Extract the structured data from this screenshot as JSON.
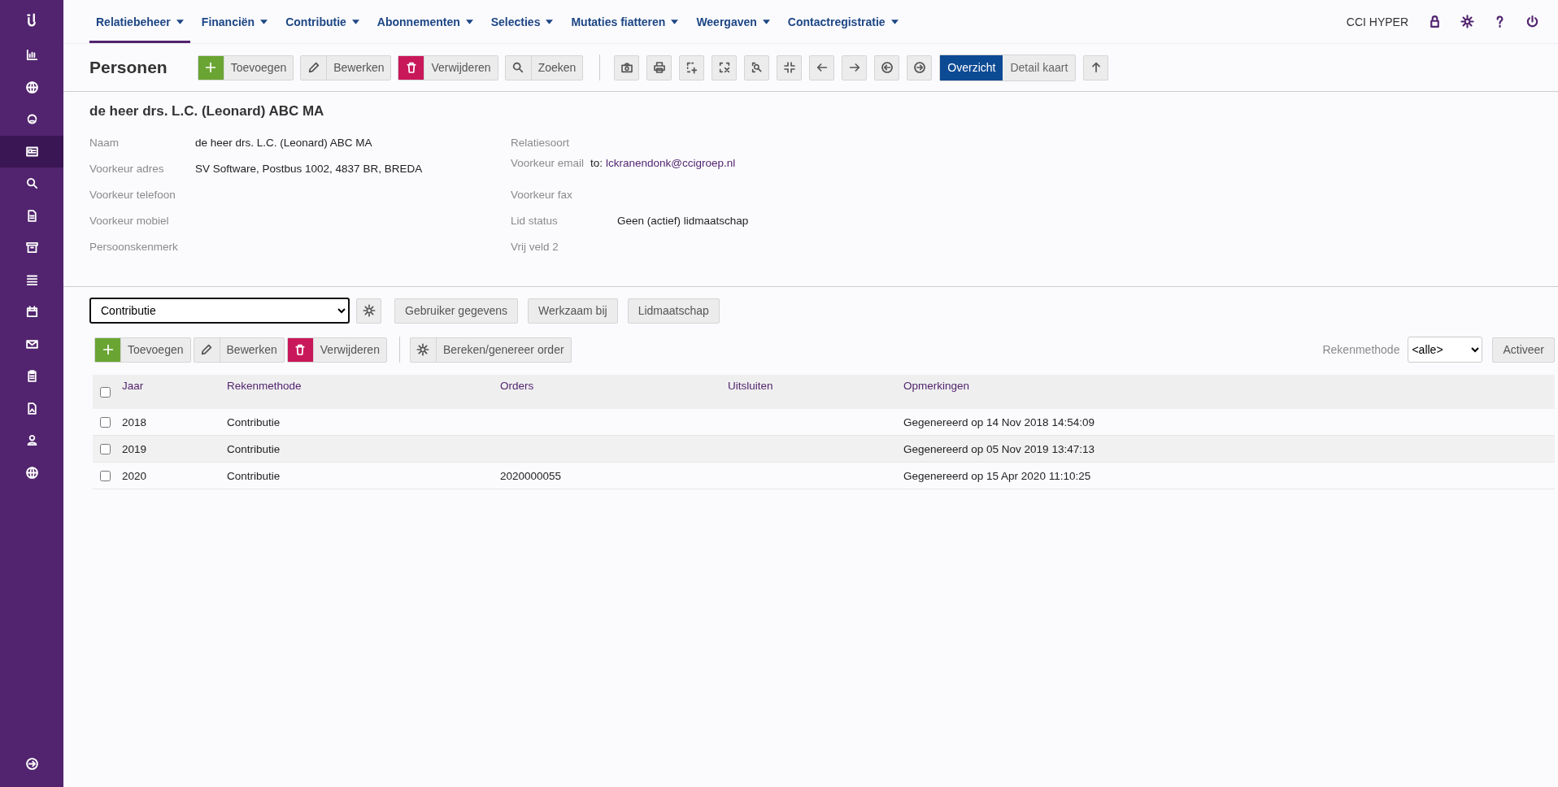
{
  "sidebar": {
    "logo": {
      "kind": "logo"
    },
    "items": [
      {
        "kind": "chart",
        "selected": false
      },
      {
        "kind": "globe",
        "selected": false
      },
      {
        "kind": "circle",
        "selected": false
      },
      {
        "kind": "idcard",
        "selected": true
      },
      {
        "kind": "search",
        "selected": false
      },
      {
        "kind": "document",
        "selected": false
      },
      {
        "kind": "archive",
        "selected": false
      },
      {
        "kind": "list",
        "selected": false
      },
      {
        "kind": "calendar",
        "selected": false
      },
      {
        "kind": "envelope",
        "selected": false
      },
      {
        "kind": "clipboard",
        "selected": false
      },
      {
        "kind": "fileimage",
        "selected": false
      },
      {
        "kind": "user",
        "selected": false
      },
      {
        "kind": "globe",
        "selected": false
      }
    ],
    "bottom": {
      "kind": "circle-right"
    }
  },
  "top_nav": {
    "menus": [
      {
        "label": "Relatiebeheer",
        "selected": true
      },
      {
        "label": "Financiën",
        "selected": false
      },
      {
        "label": "Contributie",
        "selected": false
      },
      {
        "label": "Abonnementen",
        "selected": false
      },
      {
        "label": "Selecties",
        "selected": false
      },
      {
        "label": "Mutaties fiatteren",
        "selected": false
      },
      {
        "label": "Weergaven",
        "selected": false
      },
      {
        "label": "Contactregistratie",
        "selected": false
      }
    ],
    "user": "CCI HYPER",
    "icons": [
      {
        "kind": "lock"
      },
      {
        "kind": "gear"
      },
      {
        "kind": "question"
      },
      {
        "kind": "power"
      }
    ]
  },
  "toolbar": {
    "title": "Personen",
    "actions": [
      {
        "kind": "add",
        "label": "Toevoegen"
      },
      {
        "kind": "edit",
        "label": "Bewerken"
      },
      {
        "kind": "delete",
        "label": "Verwijderen"
      },
      {
        "kind": "search",
        "label": "Zoeken"
      }
    ],
    "icon_buttons": [
      {
        "kind": "camera"
      },
      {
        "kind": "print"
      },
      {
        "kind": "add-selection"
      },
      {
        "kind": "remove-selection"
      },
      {
        "kind": "zoom-doc"
      },
      {
        "kind": "compress"
      },
      {
        "kind": "arrow-left"
      },
      {
        "kind": "arrow-right"
      },
      {
        "kind": "circle-left"
      },
      {
        "kind": "circle-right"
      }
    ],
    "view_toggle": [
      {
        "label": "Overzicht",
        "selected": true
      },
      {
        "label": "Detail kaart",
        "selected": false
      }
    ],
    "end_buttons": [
      {
        "kind": "arrow-up"
      }
    ]
  },
  "record": {
    "title": "de heer drs. L.C. (Leonard) ABC MA",
    "left_fields": [
      {
        "label": "Naam",
        "value": "de heer drs. L.C. (Leonard) ABC MA"
      },
      {
        "label": "Voorkeur adres",
        "value": "SV Software, Postbus 1002, 4837 BR, BREDA"
      },
      {
        "label": "Voorkeur telefoon"
      },
      {
        "label": "Voorkeur mobiel"
      },
      {
        "label": "Persoonskenmerk"
      }
    ],
    "right_fields": [
      {
        "label": "Relatiesoort"
      },
      {
        "label": "Voorkeur email",
        "kind": "email",
        "prefix": "to:",
        "value": "lckranendonk@ccigroep.nl"
      },
      {
        "label": "Voorkeur fax"
      },
      {
        "label": "Lid status",
        "value": "Geen (actief) lidmaatschap"
      },
      {
        "label": "Vrij veld 2"
      }
    ]
  },
  "panel": {
    "select": "Contributie",
    "tabs": [
      "Gebruiker gegevens",
      "Werkzaam bij",
      "Lidmaatschap"
    ],
    "actions": [
      {
        "kind": "add",
        "label": "Toevoegen"
      },
      {
        "kind": "edit",
        "label": "Bewerken"
      },
      {
        "kind": "delete",
        "label": "Verwijderen"
      }
    ],
    "extra_actions": [
      {
        "kind": "gear",
        "label": "Bereken/genereer order"
      }
    ],
    "filter": {
      "label": "Rekenmethode",
      "value": "<alle>",
      "button": "Activeer"
    },
    "table": {
      "header_checked": false,
      "columns": [
        "Jaar",
        "Rekenmethode",
        "Orders",
        "Uitsluiten",
        "Opmerkingen"
      ],
      "rows": [
        {
          "checked": false,
          "cells": [
            "2018",
            "Contributie",
            "",
            "",
            "Gegenereerd op 14 Nov 2018 14:54:09"
          ]
        },
        {
          "checked": false,
          "cells": [
            "2019",
            "Contributie",
            "",
            "",
            "Gegenereerd op 05 Nov 2019 13:47:13"
          ]
        },
        {
          "checked": false,
          "cells": [
            "2020",
            "Contributie",
            "2020000055",
            "",
            "Gegenereerd op 15 Apr 2020 11:10:25"
          ]
        }
      ]
    }
  }
}
